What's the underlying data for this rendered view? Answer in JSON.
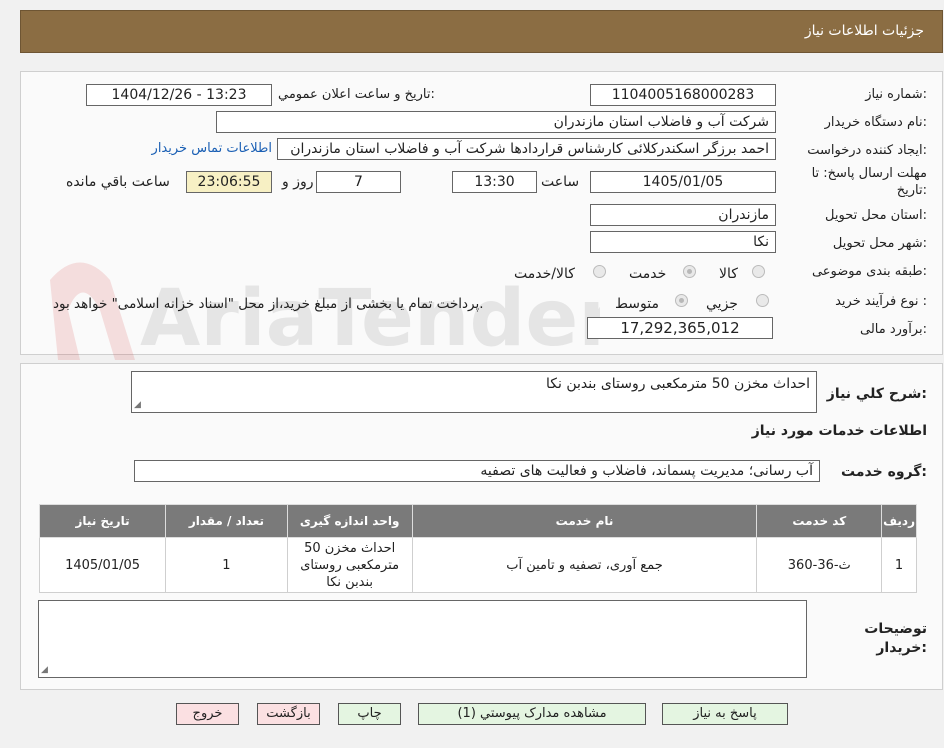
{
  "header": {
    "title": "جزئیات اطلاعات نیاز"
  },
  "fields": {
    "need_number_label": "شماره نیاز:",
    "need_number": "1104005168000283",
    "announce_label": "تاریخ و ساعت اعلان عمومي:",
    "announce_value": "1404/12/26 - 13:23",
    "buyer_org_label": "نام دستگاه خريدار:",
    "buyer_org": "شرکت آب و فاضلاب استان مازندران",
    "requester_label": "ایجاد کننده درخواست:",
    "requester": "احمد برزگر اسکندرکلائی کارشناس قراردادها شرکت آب و فاضلاب استان مازندران",
    "contact_link": "اطلاعات تماس خريدار",
    "deadline_label": "مهلت ارسال پاسخ: تا تاریخ:",
    "deadline_date": "1405/01/05",
    "time_label": "ساعت",
    "deadline_time": "13:30",
    "days": "7",
    "days_label": "روز و",
    "remaining": "23:06:55",
    "remaining_label": "ساعت باقي مانده",
    "province_label": "استان محل تحویل:",
    "province": "مازندران",
    "city_label": "شهر محل تحویل:",
    "city": "نکا",
    "category_label": "طبقه بندی موضوعی:",
    "category_options": [
      "کالا",
      "خدمت",
      "کالا/خدمت"
    ],
    "process_label": "نوع فرآیند خرید :",
    "process_options": [
      "جزیي",
      "متوسط"
    ],
    "process_note": "پرداخت تمام یا بخشی از مبلغ خرید،از محل \"اسناد خزانه اسلامی\" خواهد بود.",
    "budget_label": "برآورد مالی:",
    "budget": "17,292,365,012"
  },
  "watermark": {
    "text": "AriaTender.net"
  },
  "description": {
    "label": "شرح کلي نياز:",
    "value": "احداث مخزن 50 مترمکعبی روستای بندبن نکا"
  },
  "services": {
    "section_title": "اطلاعات خدمات مورد نیاز",
    "group_label": "گروه خدمت:",
    "group_value": "آب رسانی؛ مدیریت پسماند، فاضلاب و فعالیت های تصفیه",
    "columns": [
      "رديف",
      "کد خدمت",
      "نام خدمت",
      "واحد اندازه گیری",
      "تعداد / مقدار",
      "تاریخ نیاز"
    ],
    "rows": [
      [
        "1",
        "ث-36-360",
        "جمع آوری، تصفیه و تامین آب",
        "احداث مخزن 50 مترمکعبی روستای بندبن نکا",
        "1",
        "1405/01/05"
      ]
    ]
  },
  "buyer_notes": {
    "label": "توضیحات خریدار:",
    "value": ""
  },
  "buttons": {
    "reply": "پاسخ به نیاز",
    "attachments": "مشاهده مدارک پیوستي (1)",
    "print": "چاپ",
    "back": "بازگشت",
    "exit": "خروج"
  }
}
